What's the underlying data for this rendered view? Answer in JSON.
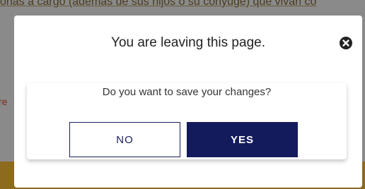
{
  "background": {
    "top_text": "onas a cargo (además de sus hijos o su cónyuge) que vivan co",
    "left_fragment": "re"
  },
  "dialog": {
    "title": "You are leaving this page.",
    "close_icon": "close-circle-icon",
    "question": "Do you want to save your changes?",
    "no_label": "NO",
    "yes_label": "YES"
  },
  "colors": {
    "primary": "#141b5c",
    "overlay": "#8a8a8a",
    "footer_band": "#8c6a1e"
  }
}
